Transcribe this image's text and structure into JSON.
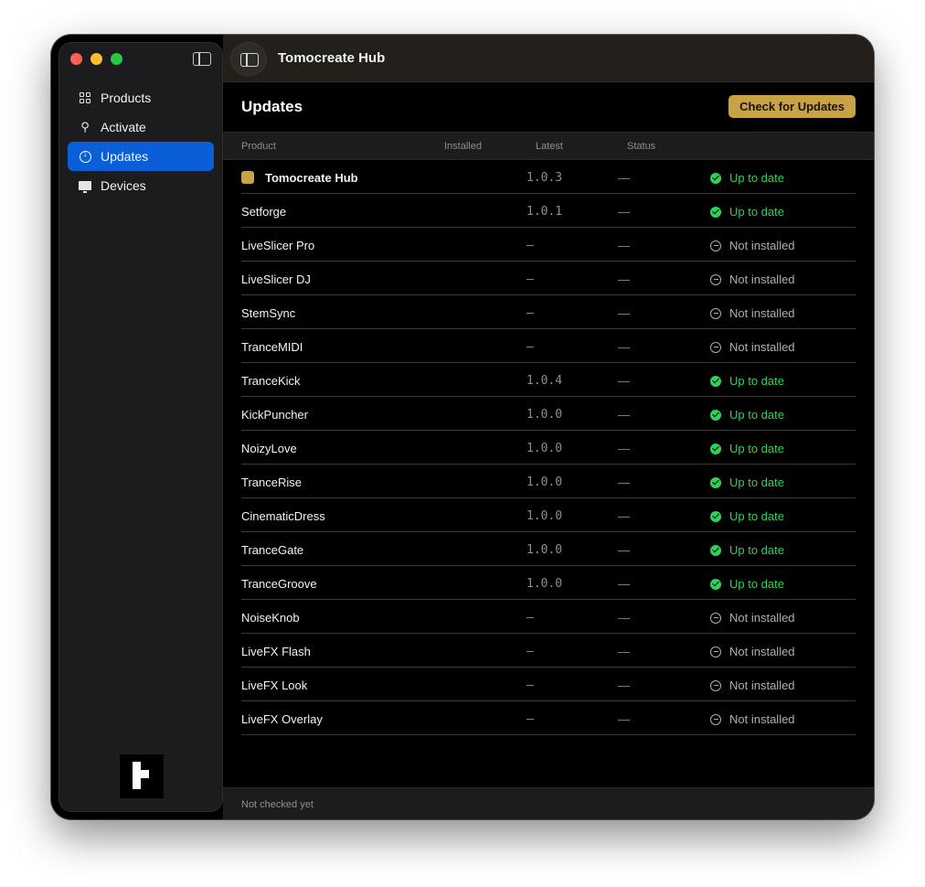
{
  "app": {
    "title": "Tomocreate Hub"
  },
  "sidebar": {
    "items": [
      {
        "label": "Products",
        "icon": "grid-icon",
        "active": false
      },
      {
        "label": "Activate",
        "icon": "key-icon",
        "active": false
      },
      {
        "label": "Updates",
        "icon": "download-icon",
        "active": true
      },
      {
        "label": "Devices",
        "icon": "monitor-icon",
        "active": false
      }
    ]
  },
  "main": {
    "title": "Updates",
    "check_button": "Check for Updates",
    "columns": {
      "product": "Product",
      "installed": "Installed",
      "latest": "Latest",
      "status": "Status"
    },
    "rows": [
      {
        "product": "Tomocreate Hub",
        "installed": "1.0.3",
        "latest": "—",
        "status": "Up to date",
        "ok": true,
        "hub": true
      },
      {
        "product": "Setforge",
        "installed": "1.0.1",
        "latest": "—",
        "status": "Up to date",
        "ok": true
      },
      {
        "product": "LiveSlicer Pro",
        "installed": "—",
        "latest": "—",
        "status": "Not installed",
        "ok": false
      },
      {
        "product": "LiveSlicer DJ",
        "installed": "—",
        "latest": "—",
        "status": "Not installed",
        "ok": false
      },
      {
        "product": "StemSync",
        "installed": "—",
        "latest": "—",
        "status": "Not installed",
        "ok": false
      },
      {
        "product": "TranceMIDI",
        "installed": "—",
        "latest": "—",
        "status": "Not installed",
        "ok": false
      },
      {
        "product": "TranceKick",
        "installed": "1.0.4",
        "latest": "—",
        "status": "Up to date",
        "ok": true
      },
      {
        "product": "KickPuncher",
        "installed": "1.0.0",
        "latest": "—",
        "status": "Up to date",
        "ok": true
      },
      {
        "product": "NoizyLove",
        "installed": "1.0.0",
        "latest": "—",
        "status": "Up to date",
        "ok": true
      },
      {
        "product": "TranceRise",
        "installed": "1.0.0",
        "latest": "—",
        "status": "Up to date",
        "ok": true
      },
      {
        "product": "CinematicDress",
        "installed": "1.0.0",
        "latest": "—",
        "status": "Up to date",
        "ok": true
      },
      {
        "product": "TranceGate",
        "installed": "1.0.0",
        "latest": "—",
        "status": "Up to date",
        "ok": true
      },
      {
        "product": "TranceGroove",
        "installed": "1.0.0",
        "latest": "—",
        "status": "Up to date",
        "ok": true
      },
      {
        "product": "NoiseKnob",
        "installed": "—",
        "latest": "—",
        "status": "Not installed",
        "ok": false
      },
      {
        "product": "LiveFX Flash",
        "installed": "—",
        "latest": "—",
        "status": "Not installed",
        "ok": false
      },
      {
        "product": "LiveFX Look",
        "installed": "—",
        "latest": "—",
        "status": "Not installed",
        "ok": false
      },
      {
        "product": "LiveFX Overlay",
        "installed": "—",
        "latest": "—",
        "status": "Not installed",
        "ok": false
      }
    ]
  },
  "footer": {
    "status": "Not checked yet"
  },
  "colors": {
    "accent": "#0a5ed7",
    "button": "#c9a246",
    "ok": "#30d158",
    "muted": "#aeaeb2"
  }
}
